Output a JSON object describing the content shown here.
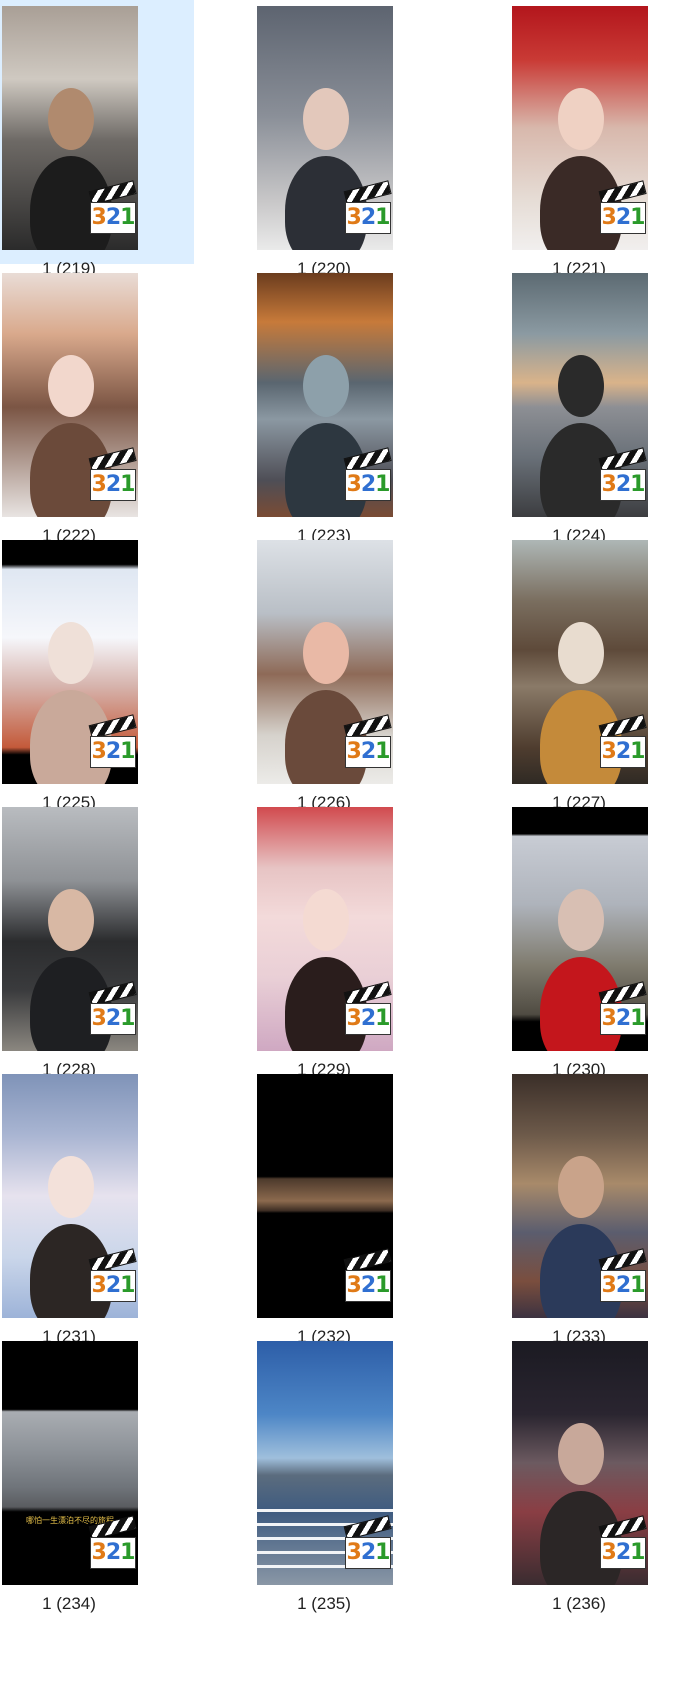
{
  "items": [
    {
      "label": "1 (219)",
      "selected": true,
      "bg": "linear-gradient(180deg,#a99f96 0%,#cfc9c1 30%,#6e6a66 55%,#2b2b2b 100%)",
      "person": "#1c1c1c",
      "skin": "#b08a6e"
    },
    {
      "label": "1 (220)",
      "selected": false,
      "bg": "linear-gradient(180deg,#5d6470 0%,#8a8f98 45%,#c8c7c8 80%,#eaeaea 100%)",
      "person": "#2c2f36",
      "skin": "#e3c8bb"
    },
    {
      "label": "1 (221)",
      "selected": false,
      "bg": "linear-gradient(180deg,#b3161c 0%,#c93a35 22%,#d8b8ac 50%,#e6ddd6 80%,#f1efee 100%)",
      "person": "#3a2a26",
      "skin": "#efd1c3"
    },
    {
      "label": "1 (222)",
      "selected": false,
      "bg": "linear-gradient(180deg,#e9dcd6 0%,#d9a98c 25%,#7b5544 55%,#e8e4e2 100%)",
      "person": "#6b4a3a",
      "skin": "#f2d7cc"
    },
    {
      "label": "1 (223)",
      "selected": false,
      "bg": "linear-gradient(180deg,#6b3c1e 0%,#c77a3a 20%,#5a6670 45%,#8b98a2 60%,#4e4e56 85%,#7a4b34 100%)",
      "person": "#2d3740",
      "skin": "#8da0aa"
    },
    {
      "label": "1 (224)",
      "selected": false,
      "bg": "linear-gradient(180deg,#5c6a72 0%,#8b9aa2 25%,#d9b38a 45%,#8d8f94 55%,#6a7179 75%,#3c3d40 100%)",
      "person": "#2a2a2a",
      "skin": "#2a2a2a"
    },
    {
      "label": "1 (225)",
      "selected": false,
      "bg": "linear-gradient(180deg,#000 0%,#000 10%,#dfe7f2 12%,#f6f7fb 40%,#d6b3ac 60%,#c45a3a 85%,#000 88%,#000 100%)",
      "person": "#c9a99a",
      "skin": "#efe0d8"
    },
    {
      "label": "1 (226)",
      "selected": false,
      "bg": "linear-gradient(180deg,#dde1e6 0%,#b9bfc6 30%,#8e6a57 55%,#d6d2cc 80%,#ecebe8 100%)",
      "person": "#6a4a3b",
      "skin": "#e9b9a6"
    },
    {
      "label": "1 (227)",
      "selected": false,
      "bg": "linear-gradient(180deg,#aeb7b6 0%,#7a6e5f 25%,#5e4a3a 45%,#8a7a68 60%,#4f3d2f 85%,#2f2a24 100%)",
      "person": "#c48a3a",
      "skin": "#e8dccf"
    },
    {
      "label": "1 (228)",
      "selected": false,
      "bg": "linear-gradient(180deg,#b9bcc0 0%,#8f9296 30%,#2b2c2e 55%,#3a3b3d 75%,#8b8780 100%)",
      "person": "#1e1f22",
      "skin": "#d8b8a4"
    },
    {
      "label": "1 (229)",
      "selected": false,
      "bg": "linear-gradient(180deg,#d14a4e 0%,#e7c4c4 25%,#f3dada 45%,#e9cfd6 70%,#cfa8c2 100%)",
      "person": "#2a1d1c",
      "skin": "#f4dad2"
    },
    {
      "label": "1 (230)",
      "selected": false,
      "bg": "linear-gradient(180deg,#000 0%,#000 11%,#c8ccd4 12%,#aeb3bb 40%,#7f7b6e 65%,#4f4b42 85%,#000 88%,#000 100%)",
      "person": "#c4161c",
      "skin": "#d8bfb3"
    },
    {
      "label": "1 (231)",
      "selected": false,
      "bg": "linear-gradient(180deg,#7f93b8 0%,#a9b5d2 25%,#e6e2ee 50%,#cad6ea 75%,#9db3d8 100%)",
      "person": "#2c2624",
      "skin": "#f3e1da"
    },
    {
      "label": "1 (232)",
      "selected": false,
      "bg": "linear-gradient(180deg,#000 0%,#000 42%,#4d3a2c 43%,#8c6a4e 52%,#3e2e24 56%,#000 57%,#000 100%)",
      "person": "#000000",
      "skin": "#000000"
    },
    {
      "label": "1 (233)",
      "selected": false,
      "bg": "linear-gradient(180deg,#3a2e28 0%,#6d5a4a 25%,#a88a6a 45%,#5b5d6e 65%,#7a4e3e 85%,#3c3240 100%)",
      "person": "#2b3a5a",
      "skin": "#c9a38a"
    },
    {
      "label": "1 (234)",
      "selected": false,
      "bg": "linear-gradient(180deg,#000 0%,#000 28%,#a9adb2 29%,#8d9298 45%,#6f747a 60%,#5a5c60 68%,#000 70%,#000 100%)",
      "person": "#000000",
      "skin": "#000000"
    },
    {
      "label": "1 (235)",
      "selected": false,
      "bg": "linear-gradient(180deg,#2d5ea8 0%,#4d86c6 30%,#9fbfdc 48%,#5b6c7e 55%,#3e5b80 70%,#8a97a6 100%)",
      "person": "#ffffff",
      "skin": "#ffffff"
    },
    {
      "label": "1 (236)",
      "selected": false,
      "bg": "linear-gradient(180deg,#1b1a22 0%,#2a2530 30%,#6c5a60 50%,#8a3e44 70%,#3a2c30 100%)",
      "person": "#2b2626",
      "skin": "#c8a89a"
    }
  ],
  "badge": {
    "digit_3": "3",
    "digit_2": "2",
    "digit_1": "1",
    "icon": "media-player-classic-clapperboard-icon"
  },
  "overlays": {
    "234_caption": "哪怕一生漂泊不尽的旅程"
  }
}
